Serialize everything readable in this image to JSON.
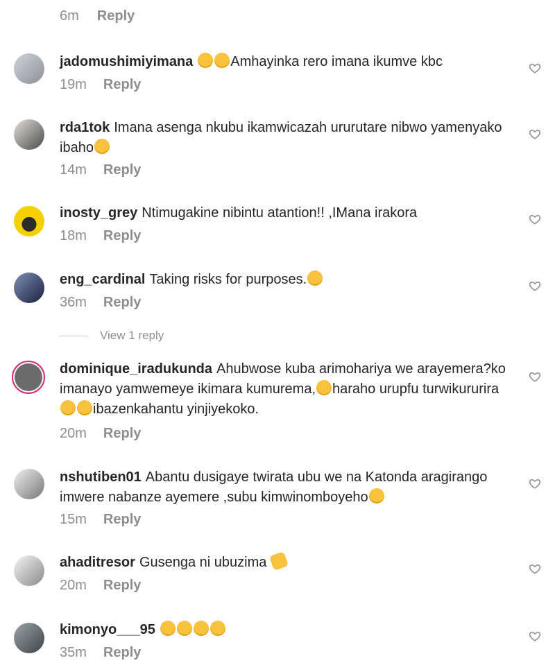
{
  "top": {
    "time": "6m",
    "reply": "Reply"
  },
  "comments": [
    {
      "user": "jadomushimiyimana",
      "pre": "",
      "text": "Amhayinka rero imana ikumve kbc",
      "time": "19m",
      "reply": "Reply",
      "emoji_lead": [
        "open-mouth-face-emoji",
        "open-mouth-face-emoji"
      ]
    },
    {
      "user": "rda1tok",
      "text": "Imana asenga nkubu ikamwicazah ururutare nibwo yamenyako ibaho",
      "time": "14m",
      "reply": "Reply",
      "emoji_tail": [
        "tears-of-joy-emoji"
      ]
    },
    {
      "user": "inosty_grey",
      "text": "Ntimugakine nibintu atantion!! ,IMana irakora",
      "time": "18m",
      "reply": "Reply"
    },
    {
      "user": "eng_cardinal",
      "text": "Taking risks for purposes.",
      "time": "36m",
      "reply": "Reply",
      "emoji_tail": [
        "relieved-face-emoji"
      ]
    },
    {
      "user": "dominique_iradukunda",
      "text": "Ahubwose kuba arimohariya we arayemera?ko imanayo yamwemeye ikimara kumurema,",
      "text2": "haraho urupfu turwikururira",
      "text3": "ibazenkahantu yinjiyekoko.",
      "time": "20m",
      "reply": "Reply"
    },
    {
      "user": "nshutiben01",
      "text": "Abantu dusigaye twirata ubu we na Katonda aragirango imwere nabanze ayemere ,subu kimwinomboyeho",
      "time": "15m",
      "reply": "Reply"
    },
    {
      "user": "ahaditresor",
      "text": "Gusenga ni ubuzima",
      "time": "20m",
      "reply": "Reply"
    },
    {
      "user": "kimonyo___95",
      "text": "",
      "time": "35m",
      "reply": "Reply"
    }
  ],
  "view_replies": "View 1 reply",
  "colors": {
    "muted": "#8e8e8e",
    "text": "#262626",
    "emoji": "#f9c23c",
    "ring": "#d62976"
  },
  "icons": {
    "like": "heart-outline-icon"
  }
}
